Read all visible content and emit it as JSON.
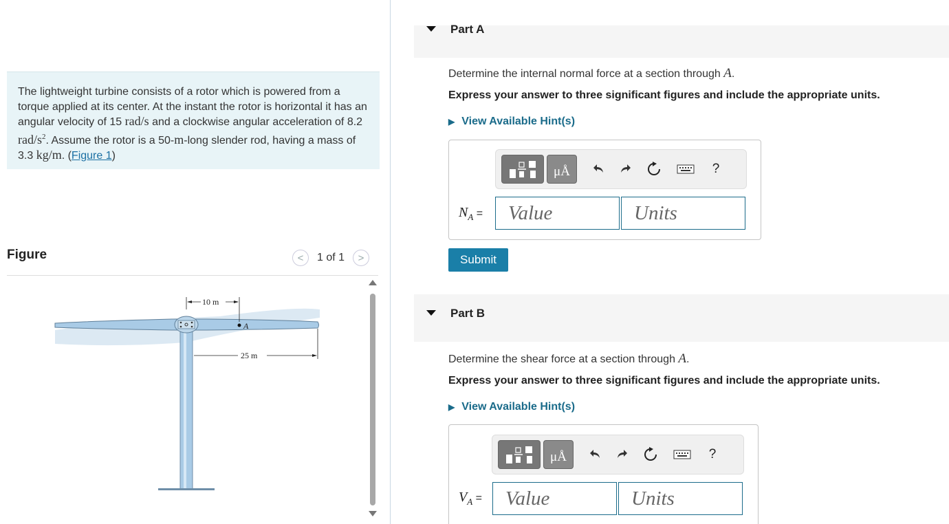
{
  "problem": {
    "part1": "The lightweight turbine consists of a rotor which is powered from a torque applied at its center. At the instant the rotor is horizontal it has an angular velocity of 15 ",
    "unit_rads": "rad/s",
    "part2": " and a clockwise angular acceleration of 8.2 ",
    "unit_rads2": "rad/s",
    "sup2": "2",
    "part3": ". Assume the rotor is a 50-",
    "unit_m": "m",
    "part4": "-long slender rod, having a mass of 3.3 ",
    "unit_kgm": "kg/m",
    "part5": ". (",
    "figure_link": "Figure 1",
    "part6": ")"
  },
  "figure": {
    "title": "Figure",
    "pager_text": "1 of 1",
    "prev_glyph": "<",
    "next_glyph": ">",
    "dim_10m": "10 m",
    "dim_25m": "25 m",
    "point_label": "A"
  },
  "partA": {
    "label": "Part A",
    "question_prefix": "Determine the internal normal force at a section through ",
    "question_var": "A",
    "question_suffix": ".",
    "instruction": "Express your answer to three significant figures and include the appropriate units.",
    "hint": "View Available Hint(s)",
    "var_main": "N",
    "var_sub": "A",
    "equals": " =",
    "value_placeholder": "Value",
    "units_placeholder": "Units",
    "submit": "Submit"
  },
  "partB": {
    "label": "Part B",
    "question_prefix": "Determine the shear force at a section through ",
    "question_var": "A",
    "question_suffix": ".",
    "instruction": "Express your answer to three significant figures and include the appropriate units.",
    "hint": "View Available Hint(s)",
    "var_main": "V",
    "var_sub": "A",
    "equals": " =",
    "value_placeholder": "Value",
    "units_placeholder": "Units"
  },
  "toolbar": {
    "mu_label": "μÅ",
    "help": "?"
  },
  "colors": {
    "accent": "#1a7fa8",
    "hint": "#1a6b8a",
    "problem_bg": "#e8f4f7",
    "turbine": "#a9cbe6"
  }
}
